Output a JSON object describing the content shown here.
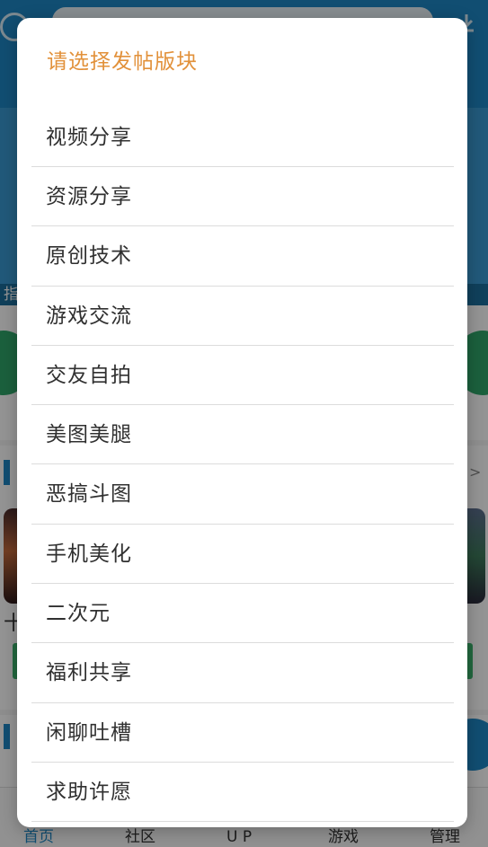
{
  "background": {
    "notice_char": "指",
    "section_more": ">",
    "plus_char": "十",
    "bottom_nav": [
      "首页",
      "社区",
      "U P",
      "游戏",
      "管理"
    ],
    "active_tab": "首页"
  },
  "dialog": {
    "title": "请选择发帖版块",
    "options": [
      "视频分享",
      "资源分享",
      "原创技术",
      "游戏交流",
      "交友自拍",
      "美图美腿",
      "恶搞斗图",
      "手机美化",
      "二次元",
      "福利共享",
      "闲聊吐槽",
      "求助许愿"
    ]
  },
  "colors": {
    "accent": "#1e87c4",
    "title": "#e2913a",
    "green": "#2fa56a"
  }
}
